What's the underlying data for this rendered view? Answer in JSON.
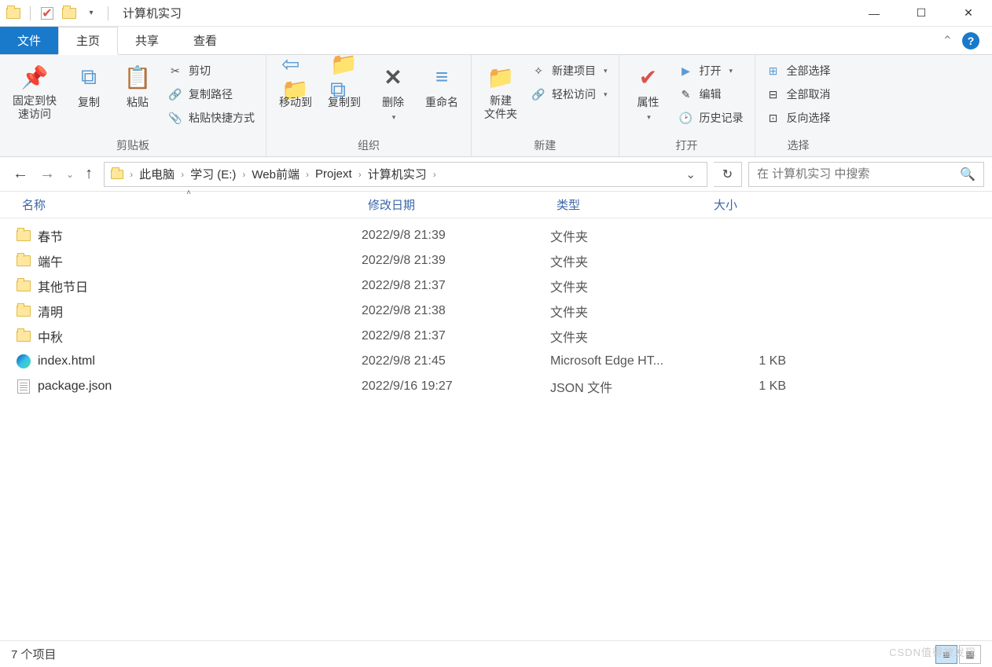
{
  "window": {
    "title": "计算机实习"
  },
  "tabs": {
    "file": "文件",
    "home": "主页",
    "share": "共享",
    "view": "查看"
  },
  "ribbon": {
    "clipboard": {
      "label": "剪贴板",
      "pin": "固定到快\n速访问",
      "copy": "复制",
      "paste": "粘贴",
      "cut": "剪切",
      "copypath": "复制路径",
      "pasteshortcut": "粘贴快捷方式"
    },
    "organize": {
      "label": "组织",
      "moveto": "移动到",
      "copyto": "复制到",
      "delete": "删除",
      "rename": "重命名"
    },
    "new": {
      "label": "新建",
      "newfolder": "新建\n文件夹",
      "newitem": "新建项目",
      "easyaccess": "轻松访问"
    },
    "open": {
      "label": "打开",
      "properties": "属性",
      "open": "打开",
      "edit": "编辑",
      "history": "历史记录"
    },
    "select": {
      "label": "选择",
      "selectall": "全部选择",
      "selectnone": "全部取消",
      "invert": "反向选择"
    }
  },
  "breadcrumb": {
    "items": [
      "此电脑",
      "学习 (E:)",
      "Web前端",
      "Projext",
      "计算机实习"
    ]
  },
  "search": {
    "placeholder": "在 计算机实习 中搜索"
  },
  "columns": {
    "name": "名称",
    "date": "修改日期",
    "type": "类型",
    "size": "大小"
  },
  "files": [
    {
      "icon": "folder",
      "name": "春节",
      "date": "2022/9/8 21:39",
      "type": "文件夹",
      "size": ""
    },
    {
      "icon": "folder",
      "name": "端午",
      "date": "2022/9/8 21:39",
      "type": "文件夹",
      "size": ""
    },
    {
      "icon": "folder",
      "name": "其他节日",
      "date": "2022/9/8 21:37",
      "type": "文件夹",
      "size": ""
    },
    {
      "icon": "folder",
      "name": "清明",
      "date": "2022/9/8 21:38",
      "type": "文件夹",
      "size": ""
    },
    {
      "icon": "folder",
      "name": "中秋",
      "date": "2022/9/8 21:37",
      "type": "文件夹",
      "size": ""
    },
    {
      "icon": "edge",
      "name": "index.html",
      "date": "2022/9/8 21:45",
      "type": "Microsoft Edge HT...",
      "size": "1 KB"
    },
    {
      "icon": "json",
      "name": "package.json",
      "date": "2022/9/16 19:27",
      "type": "JSON 文件",
      "size": "1 KB"
    }
  ],
  "status": {
    "count": "7 个项目"
  },
  "watermark": "CSDN值得被发现"
}
